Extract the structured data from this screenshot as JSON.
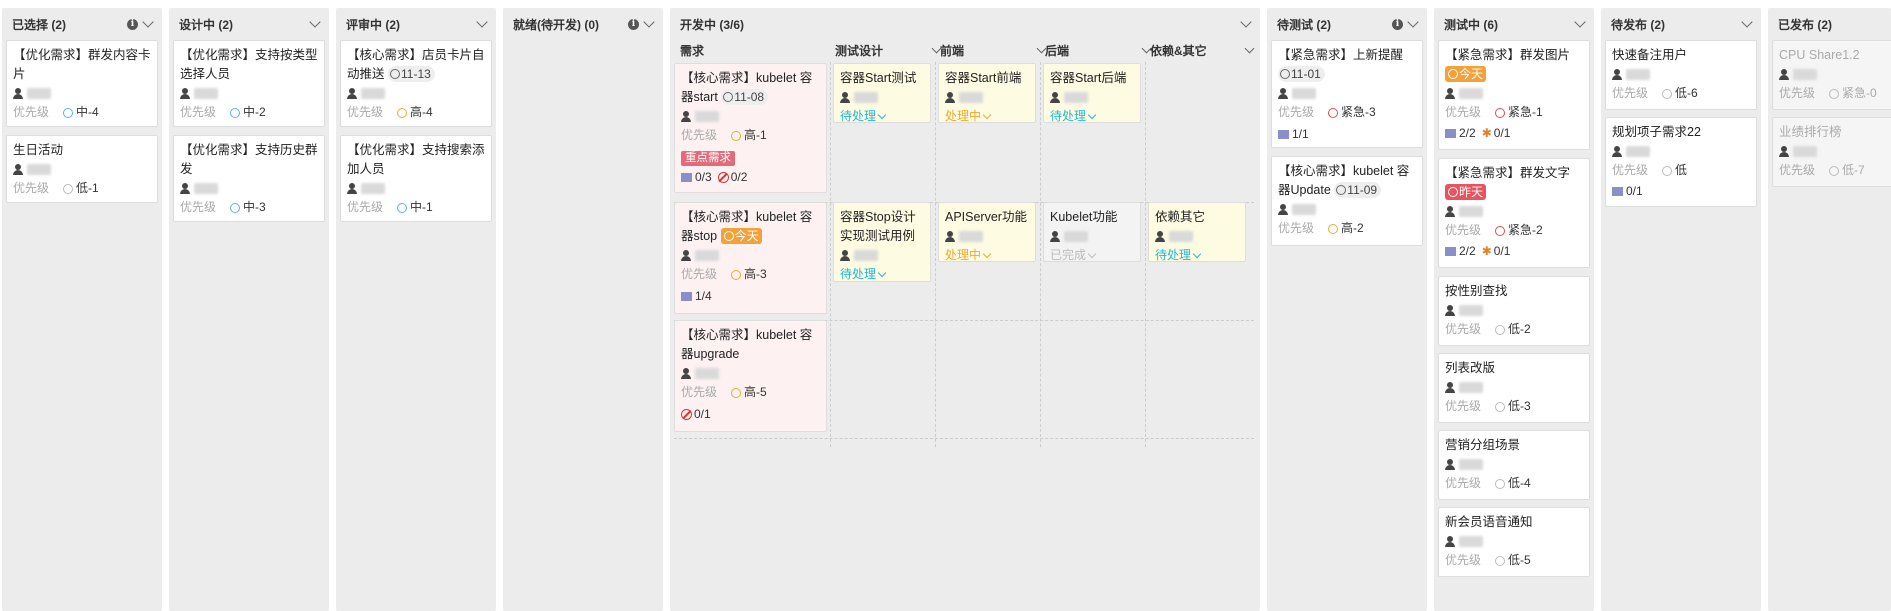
{
  "colors": {
    "accent_orange": "#f5a13a",
    "accent_red": "#e5545f",
    "pending": "#26b6d6",
    "doing": "#f0a830",
    "board_bg": "#ececec"
  },
  "priority_label": "优先级",
  "columns": [
    {
      "title": "已选择 (2)",
      "cards": [
        {
          "title": "【优化需求】群发内容卡片",
          "priority": "中-4"
        },
        {
          "title": "生日活动",
          "priority": "低-1"
        }
      ]
    },
    {
      "title": "设计中 (2)",
      "cards": [
        {
          "title": "【优化需求】支持按类型选择人员",
          "priority": "中-2"
        },
        {
          "title": "【优化需求】支持历史群发",
          "priority": "中-3"
        }
      ]
    },
    {
      "title": "评审中 (2)",
      "cards": [
        {
          "title": "【核心需求】店员卡片自动推送",
          "date": "11-13",
          "priority": "高-4"
        },
        {
          "title": "【优化需求】支持搜索添加人员",
          "priority": "中-1"
        }
      ]
    },
    {
      "title": "就绪(待开发) (0)",
      "cards": []
    },
    {
      "title": "开发中 (3/6)",
      "subcols": [
        "需求",
        "测试设计",
        "前端",
        "后端",
        "依赖&其它"
      ],
      "rows": [
        {
          "req": {
            "title": "【核心需求】kubelet 容器start",
            "date": "11-08",
            "priority": "高-1",
            "tag": "重点需求",
            "subtasks": "0/3",
            "blocked": "0/2"
          },
          "tasks": [
            {
              "col": 1,
              "title": "容器Start测试",
              "status": "待处理"
            },
            {
              "col": 2,
              "title": "容器Start前端",
              "status": "处理中"
            },
            {
              "col": 3,
              "title": "容器Start后端",
              "status": "待处理"
            }
          ]
        },
        {
          "req": {
            "title": "【核心需求】kubelet 容器stop",
            "due": "今天",
            "priority": "高-3",
            "subtasks": "1/4"
          },
          "tasks": [
            {
              "col": 1,
              "title": "容器Stop设计实现测试用例",
              "status": "待处理"
            },
            {
              "col": 2,
              "title": "APIServer功能",
              "status": "处理中"
            },
            {
              "col": 3,
              "title": "Kubelet功能",
              "status": "已完成"
            },
            {
              "col": 4,
              "title": "依赖其它",
              "status": "待处理"
            }
          ]
        },
        {
          "req": {
            "title": "【核心需求】kubelet 容器upgrade",
            "priority": "高-5",
            "blocked": "0/1"
          },
          "tasks": []
        }
      ]
    },
    {
      "title": "待测试 (2)",
      "cards": [
        {
          "title": "【紧急需求】上新提醒",
          "date": "11-01",
          "priority": "紧急-3",
          "subtasks": "1/1"
        },
        {
          "title": "【核心需求】kubelet 容器Update",
          "date": "11-09",
          "priority": "高-2"
        }
      ]
    },
    {
      "title": "测试中 (6)",
      "cards": [
        {
          "title": "【紧急需求】群发图片",
          "due": "今天",
          "priority": "紧急-1",
          "subtasks": "2/2",
          "bugs": "0/1"
        },
        {
          "title": "【紧急需求】群发文字",
          "overdue": "昨天",
          "priority": "紧急-2",
          "subtasks": "2/2",
          "bugs": "0/1"
        },
        {
          "title": "按性别查找",
          "priority": "低-2"
        },
        {
          "title": "列表改版",
          "priority": "低-3"
        },
        {
          "title": "营销分组场景",
          "priority": "低-4"
        },
        {
          "title": "新会员语音通知",
          "priority": "低-5"
        }
      ]
    },
    {
      "title": "待发布 (2)",
      "cards": [
        {
          "title": "快速备注用户",
          "priority": "低-6"
        },
        {
          "title": "规划项子需求22",
          "priority": "低",
          "subtasks": "0/1"
        }
      ]
    },
    {
      "title": "已发布 (2)",
      "cards": [
        {
          "title": "CPU Share1.2",
          "priority": "紧急-0"
        },
        {
          "title": "业绩排行榜",
          "priority": "低-7"
        }
      ]
    }
  ]
}
